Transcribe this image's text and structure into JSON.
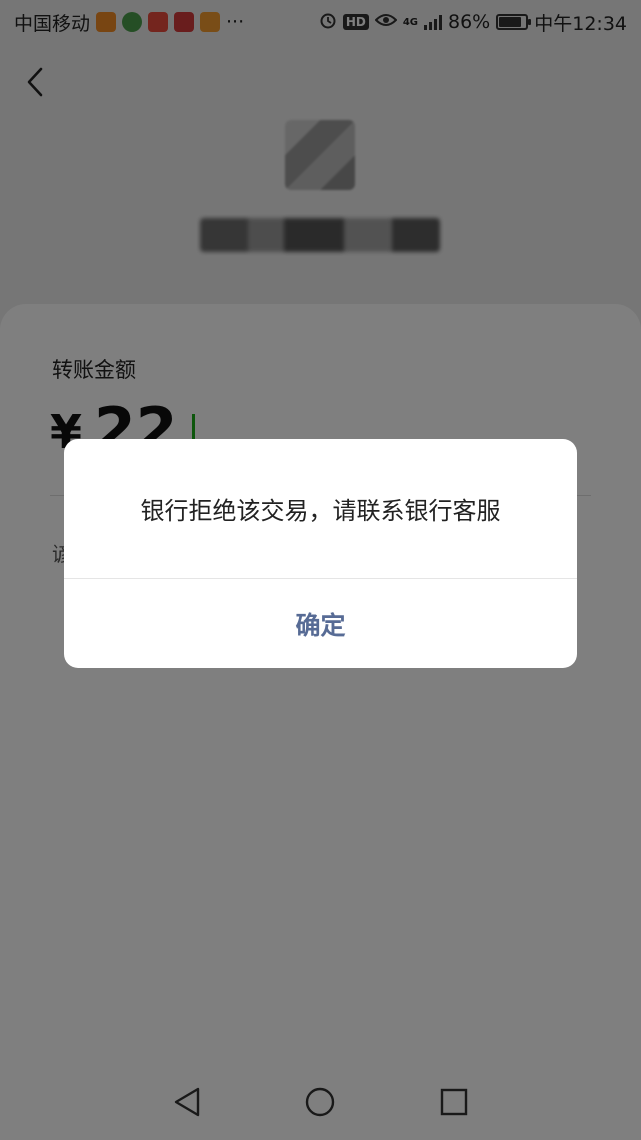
{
  "status_bar": {
    "carrier": "中国移动",
    "more": "···",
    "hd": "HD",
    "network": "4G",
    "battery": "86%",
    "time": "中午12:34",
    "battery_level": 0.86
  },
  "transfer": {
    "amount_label": "转账金额",
    "currency_symbol": "¥",
    "amount": "22",
    "remark_partial": "谚"
  },
  "dialog": {
    "message": "银行拒绝该交易，请联系银行客服",
    "confirm_label": "确定"
  },
  "colors": {
    "accent_link": "#576b95",
    "cursor": "#1aad19"
  },
  "icons": {
    "back": "chevron-left-icon",
    "nav_back": "triangle-back-icon",
    "nav_home": "circle-home-icon",
    "nav_recent": "square-recent-icon"
  }
}
